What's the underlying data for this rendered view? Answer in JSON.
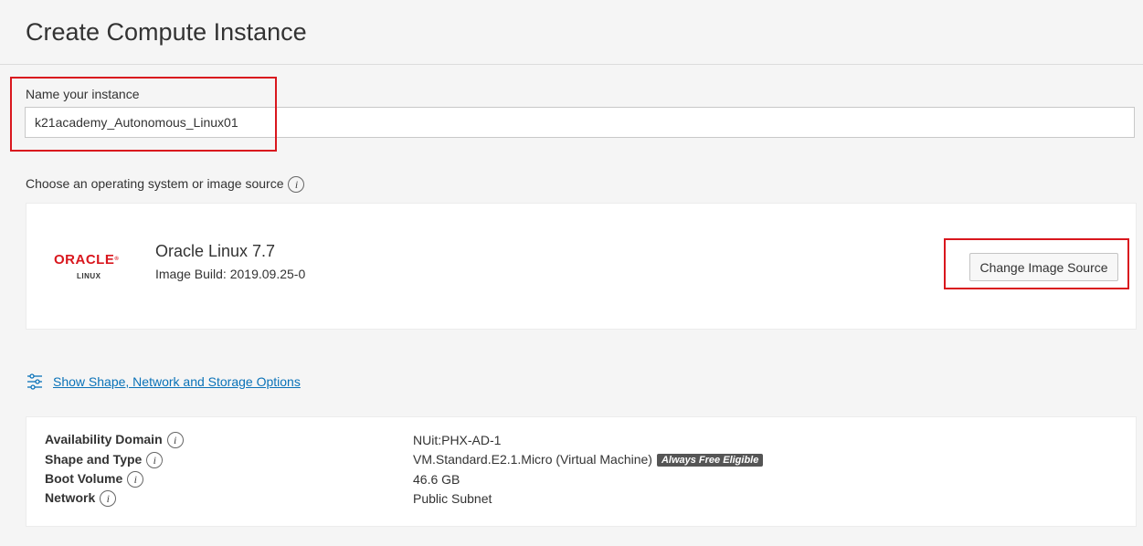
{
  "header": {
    "title": "Create Compute Instance"
  },
  "name_section": {
    "label": "Name your instance",
    "value": "k21academy_Autonomous_Linux01"
  },
  "os_section": {
    "label": "Choose an operating system or image source",
    "image": {
      "logo_brand": "ORACLE",
      "logo_sub": "LINUX",
      "name": "Oracle Linux 7.7",
      "build": "Image Build: 2019.09.25-0"
    },
    "change_button": "Change Image Source"
  },
  "options_link": {
    "label": "Show Shape, Network and Storage Options",
    "icon": "sliders-icon"
  },
  "summary": {
    "rows": [
      {
        "label": "Availability Domain",
        "value": "NUit:PHX-AD-1"
      },
      {
        "label": "Shape and Type",
        "value": "VM.Standard.E2.1.Micro (Virtual Machine)",
        "badge": "Always Free Eligible"
      },
      {
        "label": "Boot Volume",
        "value": "46.6 GB"
      },
      {
        "label": "Network",
        "value": "Public Subnet"
      }
    ]
  },
  "colors": {
    "brand_red": "#d9171e",
    "link_blue": "#0a72b8",
    "badge_bg": "#555555",
    "highlight_red": "#d9171e"
  }
}
